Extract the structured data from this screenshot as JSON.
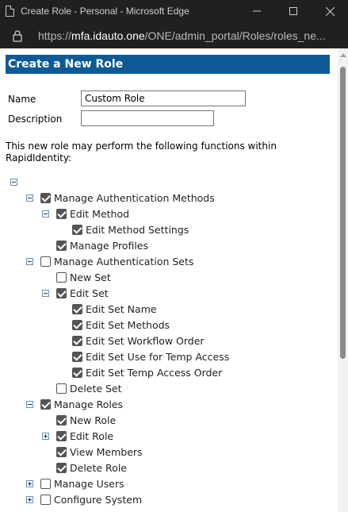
{
  "window": {
    "title": "Create Role - Personal - Microsoft Edge",
    "url_prefix": "https://",
    "url_host": "mfa.idauto.one",
    "url_path": "/ONE/admin_portal/Roles/roles_ne..."
  },
  "form": {
    "heading": "Create a New Role",
    "name_label": "Name",
    "name_value": "Custom Role",
    "description_label": "Description",
    "description_value": "",
    "intro_text": "This new role may perform the following functions within RapidIdentity:"
  },
  "tree": [
    {
      "label": "",
      "expander": "minus",
      "checkbox": false
    },
    {
      "label": "Manage Authentication Methods",
      "expander": "minus",
      "checked": true
    },
    {
      "label": "Edit Method",
      "expander": "minus",
      "checked": true
    },
    {
      "label": "Edit Method Settings",
      "expander": "",
      "checked": true
    },
    {
      "label": "Manage Profiles",
      "expander": "",
      "checked": true
    },
    {
      "label": "Manage Authentication Sets",
      "expander": "minus",
      "checked": false
    },
    {
      "label": "New Set",
      "expander": "",
      "checked": false
    },
    {
      "label": "Edit Set",
      "expander": "minus",
      "checked": true
    },
    {
      "label": "Edit Set Name",
      "expander": "",
      "checked": true
    },
    {
      "label": "Edit Set Methods",
      "expander": "",
      "checked": true
    },
    {
      "label": "Edit Set Workflow Order",
      "expander": "",
      "checked": true
    },
    {
      "label": "Edit Set Use for Temp Access",
      "expander": "",
      "checked": true
    },
    {
      "label": "Edit Set Temp Access Order",
      "expander": "",
      "checked": true
    },
    {
      "label": "Delete Set",
      "expander": "",
      "checked": false
    },
    {
      "label": "Manage Roles",
      "expander": "minus",
      "checked": true
    },
    {
      "label": "New Role",
      "expander": "",
      "checked": true
    },
    {
      "label": "Edit Role",
      "expander": "plus",
      "checked": true
    },
    {
      "label": "View Members",
      "expander": "",
      "checked": true
    },
    {
      "label": "Delete Role",
      "expander": "",
      "checked": true
    },
    {
      "label": "Manage Users",
      "expander": "plus",
      "checked": false
    },
    {
      "label": "Configure System",
      "expander": "plus",
      "checked": false
    }
  ]
}
